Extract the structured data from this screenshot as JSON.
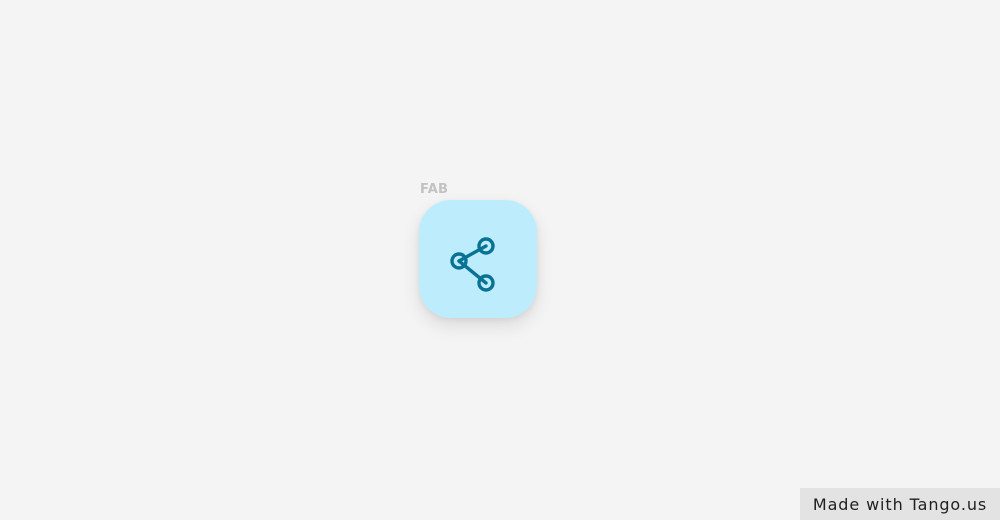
{
  "fab": {
    "label": "FAB",
    "icon": "share-icon",
    "background_color": "#bdedfd",
    "icon_color": "#0a7394"
  },
  "watermark": {
    "text": "Made with Tango.us"
  }
}
